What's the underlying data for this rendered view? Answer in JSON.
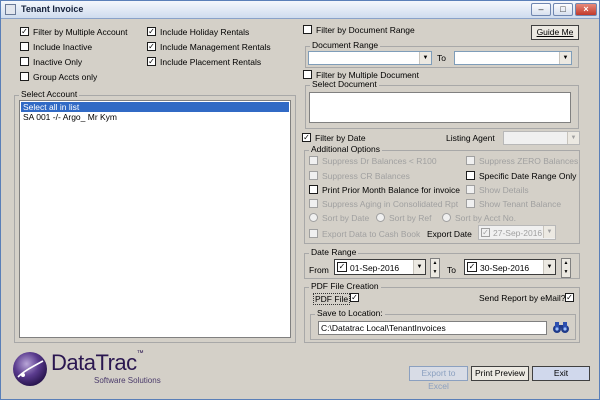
{
  "window": {
    "title": "Tenant Invoice"
  },
  "left_options": {
    "filter_multiple_account": {
      "label": "Filter by Multiple Account",
      "checked": true
    },
    "include_inactive": {
      "label": "Include Inactive",
      "checked": false
    },
    "inactive_only": {
      "label": "Inactive Only",
      "checked": false
    },
    "group_accts_only": {
      "label": "Group Accts only",
      "checked": false
    },
    "include_holiday_rentals": {
      "label": "Include Holiday Rentals",
      "checked": true
    },
    "include_management_rentals": {
      "label": "Include Management Rentals",
      "checked": true
    },
    "include_placement_rentals": {
      "label": "Include Placement Rentals",
      "checked": true
    }
  },
  "select_account": {
    "title": "Select Account",
    "items": [
      "Select all in list",
      "SA 001 -/- Argo_ Mr Kym"
    ]
  },
  "document_filter": {
    "filter_by_document_range": "Filter by Document Range",
    "document_range_title": "Document Range",
    "to_label": "To",
    "from_value": "",
    "to_value": "",
    "filter_by_multiple_document": "Filter by Multiple Document",
    "select_document_title": "Select Document"
  },
  "guide_me": "Guide Me",
  "filter_by_date": {
    "label": "Filter by Date",
    "checked": true
  },
  "listing_agent": {
    "label": "Listing Agent",
    "value": ""
  },
  "additional_options": {
    "title": "Additional Options",
    "suppress_dr": "Suppress Dr Balances < R100",
    "suppress_zero": "Suppress ZERO Balances",
    "suppress_cr": "Suppress CR Balances",
    "specific_date_range": "Specific Date Range Only",
    "print_prior_month": "Print Prior Month Balance for invoice",
    "show_details": "Show Details",
    "suppress_aging": "Suppress Aging in Consolidated Rpt",
    "show_tenant_balance": "Show Tenant Balance",
    "sort_by_date": "Sort by Date",
    "sort_by_ref": "Sort by Ref",
    "sort_by_acct": "Sort by Acct No.",
    "export_cash_book": "Export Data to Cash Book",
    "export_date_label": "Export Date",
    "export_date_value": "27-Sep-2016"
  },
  "date_range": {
    "title": "Date Range",
    "from_label": "From",
    "from_value": "01-Sep-2016",
    "to_label": "To",
    "to_value": "30-Sep-2016"
  },
  "pdf": {
    "title": "PDF File Creation",
    "pdf_file_label": "PDF File",
    "pdf_file_checked": true,
    "send_email_label": "Send Report by eMail?",
    "send_email_checked": true,
    "save_location_title": "Save to Location:",
    "save_location_value": "C:\\Datatrac Local\\TenantInvoices"
  },
  "logo": {
    "name": "DataTrac",
    "tm": "™",
    "tagline": "Software Solutions"
  },
  "footer_buttons": {
    "export_excel": "Export to Excel",
    "print_preview": "Print Preview",
    "exit": "Exit"
  }
}
